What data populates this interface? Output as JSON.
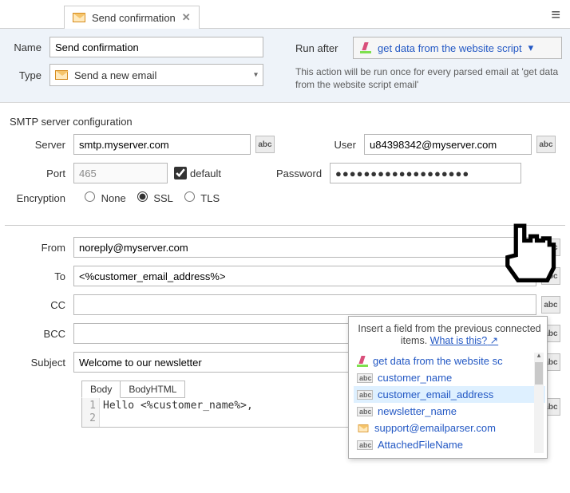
{
  "tab": {
    "title": "Send confirmation"
  },
  "header": {
    "name_label": "Name",
    "name_value": "Send confirmation",
    "type_label": "Type",
    "type_value": "Send a new email",
    "run_after_label": "Run after",
    "run_after_value": "get data from the website script",
    "helper": "This action will be run once for every parsed email at 'get data from the website script email'"
  },
  "smtp": {
    "section_title": "SMTP server configuration",
    "server_label": "Server",
    "server_value": "smtp.myserver.com",
    "port_label": "Port",
    "port_value": "465",
    "default_label": "default",
    "default_checked": true,
    "encryption_label": "Encryption",
    "enc_none": "None",
    "enc_ssl": "SSL",
    "enc_tls": "TLS",
    "enc_selected": "SSL",
    "user_label": "User",
    "user_value": "u84398342@myserver.com",
    "password_label": "Password",
    "password_value": "●●●●●●●●●●●●●●●●●●●"
  },
  "mail": {
    "from_label": "From",
    "from_value": "noreply@myserver.com",
    "to_label": "To",
    "to_value": "<%customer_email_address%>",
    "cc_label": "CC",
    "cc_value": "",
    "bcc_label": "BCC",
    "bcc_value": "",
    "subject_label": "Subject",
    "subject_value": "Welcome to our newsletter",
    "body_tab": "Body",
    "bodyhtml_tab": "BodyHTML",
    "body_text": "Hello <%customer_name%>,",
    "gutter1": "1",
    "gutter2": "2"
  },
  "popup": {
    "head_prefix": "Insert a field from the previous connected items. ",
    "head_link": "What is this?",
    "items": [
      {
        "icon": "highlighter",
        "label": "get data from the website script",
        "truncated": "get data from the website sc"
      },
      {
        "icon": "abc",
        "label": "customer_name"
      },
      {
        "icon": "abc",
        "label": "customer_email_address",
        "selected": true
      },
      {
        "icon": "abc",
        "label": "newsletter_name"
      },
      {
        "icon": "mail",
        "label": "support@emailparser.com"
      },
      {
        "icon": "abc",
        "label": "AttachedFileName"
      }
    ]
  },
  "abc": "abc"
}
